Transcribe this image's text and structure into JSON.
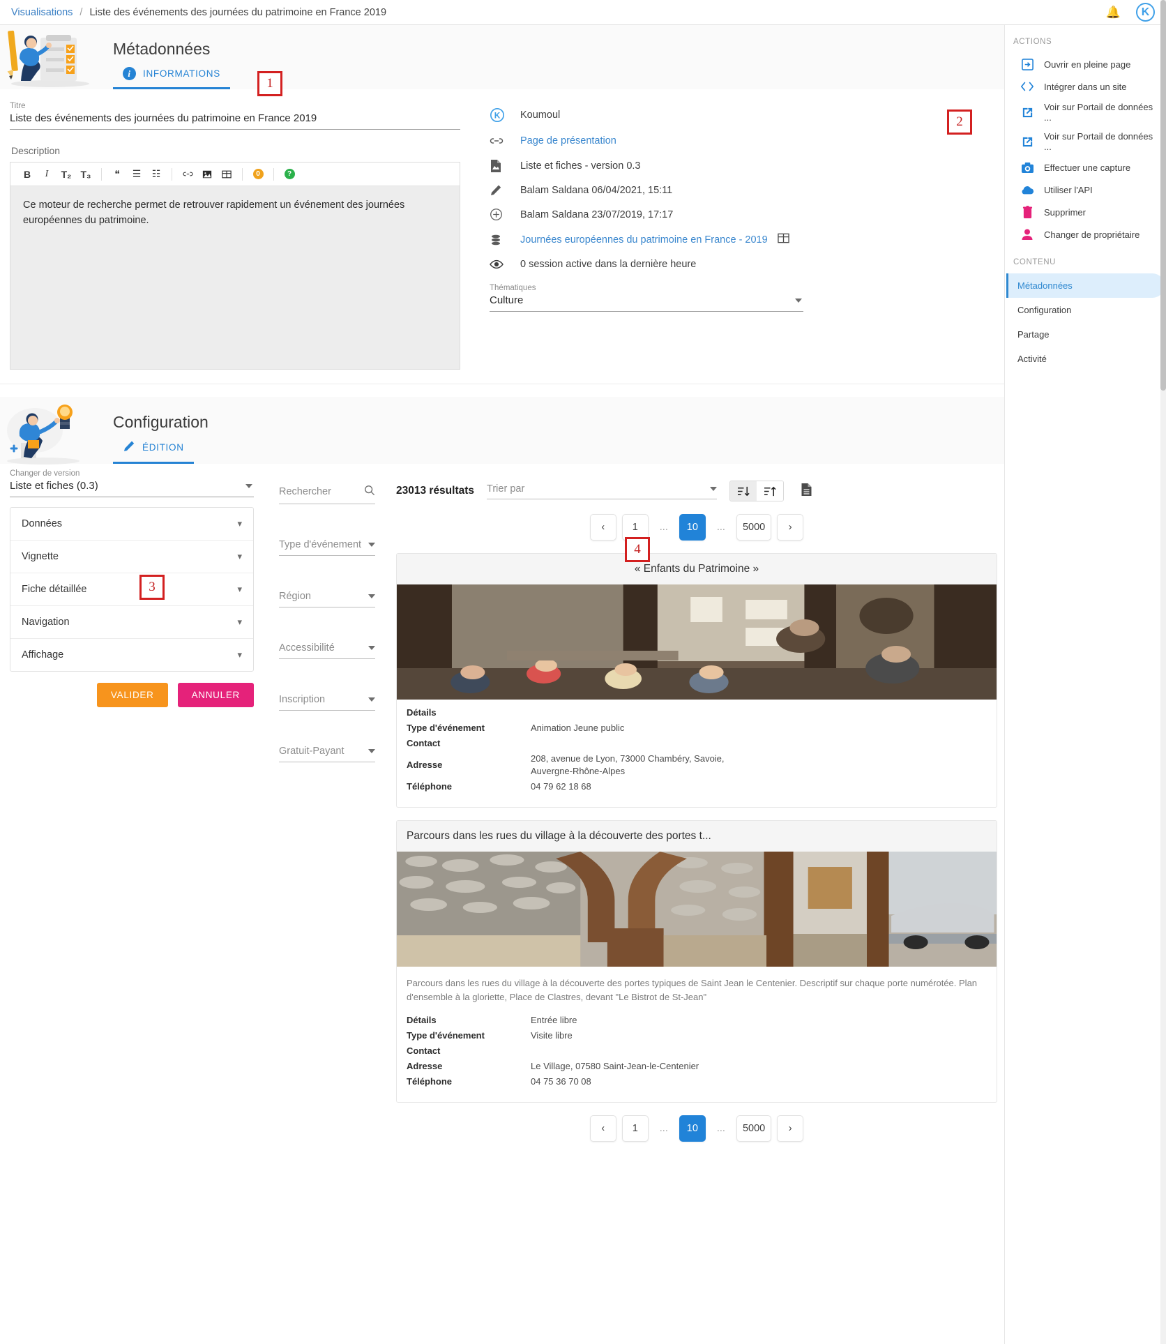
{
  "breadcrumb": {
    "root": "Visualisations",
    "separator": "/",
    "current": "Liste des événements des journées du patrimoine en France 2019"
  },
  "header": {
    "bell_icon": "bell-icon",
    "logo_letter": "K"
  },
  "metadata": {
    "title": "Métadonnées",
    "tab_label": "INFORMATIONS",
    "tab_icon": "info-icon",
    "titre_label": "Titre",
    "titre_value": "Liste des événements des journées du patrimoine en France 2019",
    "description_label": "Description",
    "description_text": "Ce moteur de recherche permet de retrouver rapidement un événement des journées européennes du patrimoine.",
    "toolbar": [
      {
        "name": "bold-icon",
        "glyph": "B"
      },
      {
        "name": "italic-icon",
        "glyph": "I"
      },
      {
        "name": "heading-2-icon",
        "glyph": "T₂"
      },
      {
        "name": "heading-3-icon",
        "glyph": "T₃"
      },
      {
        "name": "quote-icon",
        "glyph": "❝"
      },
      {
        "name": "bullet-list-icon",
        "glyph": "☰"
      },
      {
        "name": "numbered-list-icon",
        "glyph": "☷"
      },
      {
        "name": "link-icon",
        "glyph": "🔗"
      },
      {
        "name": "image-icon",
        "glyph": "▣"
      },
      {
        "name": "table-icon",
        "glyph": "⊞"
      },
      {
        "name": "preview-icon",
        "glyph": "0"
      },
      {
        "name": "help-icon",
        "glyph": "?"
      }
    ],
    "info_rows": [
      {
        "icon": "koumoul-logo-icon",
        "text": "Koumoul",
        "link": false
      },
      {
        "icon": "link-icon",
        "text": "Page de présentation",
        "link": true
      },
      {
        "icon": "file-icon",
        "text": "Liste et fiches - version 0.3",
        "link": false
      },
      {
        "icon": "pencil-icon",
        "text": "Balam Saldana 06/04/2021, 15:11",
        "link": false
      },
      {
        "icon": "plus-circle-icon",
        "text": "Balam Saldana 23/07/2019, 17:17",
        "link": false
      },
      {
        "icon": "database-icon",
        "text": "Journées européennes du patrimoine en France - 2019",
        "link": true,
        "trailing_icon": "table-icon"
      },
      {
        "icon": "eye-icon",
        "text": "0 session active dans la dernière heure",
        "link": false
      }
    ],
    "thematiques_label": "Thématiques",
    "thematiques_value": "Culture"
  },
  "rail": {
    "actions_header": "ACTIONS",
    "actions": [
      {
        "label": "Ouvrir en pleine page",
        "icon": "open-fullpage-icon",
        "color": "#2183d8"
      },
      {
        "label": "Intégrer dans un site",
        "icon": "code-embed-icon",
        "color": "#2183d8"
      },
      {
        "label": "Voir sur Portail de données ...",
        "icon": "external-link-icon",
        "color": "#2183d8"
      },
      {
        "label": "Voir sur Portail de données ...",
        "icon": "external-link-icon",
        "color": "#2183d8"
      },
      {
        "label": "Effectuer une capture",
        "icon": "camera-icon",
        "color": "#2183d8"
      },
      {
        "label": "Utiliser l'API",
        "icon": "cloud-icon",
        "color": "#2183d8"
      },
      {
        "label": "Supprimer",
        "icon": "trash-icon",
        "color": "#e5227a"
      },
      {
        "label": "Changer de propriétaire",
        "icon": "person-icon",
        "color": "#e5227a"
      }
    ],
    "contenu_header": "CONTENU",
    "contenu": [
      {
        "label": "Métadonnées",
        "active": true
      },
      {
        "label": "Configuration",
        "active": false
      },
      {
        "label": "Partage",
        "active": false
      },
      {
        "label": "Activité",
        "active": false
      }
    ]
  },
  "configuration": {
    "title": "Configuration",
    "tab_label": "ÉDITION",
    "tab_icon": "pencil-icon",
    "version_label": "Changer de version",
    "version_value": "Liste et fiches (0.3)",
    "sections": [
      {
        "label": "Données"
      },
      {
        "label": "Vignette"
      },
      {
        "label": "Fiche détaillée"
      },
      {
        "label": "Navigation"
      },
      {
        "label": "Affichage"
      }
    ],
    "validate_label": "VALIDER",
    "cancel_label": "ANNULER",
    "validate_color": "#f7941d",
    "cancel_color": "#e5227a"
  },
  "preview": {
    "filters": [
      {
        "label": "Rechercher",
        "icon": "search-icon",
        "type": "search"
      },
      {
        "label": "Type d'événement",
        "icon": "chevron-down-icon",
        "type": "select"
      },
      {
        "label": "Région",
        "icon": "chevron-down-icon",
        "type": "select"
      },
      {
        "label": "Accessibilité",
        "icon": "chevron-down-icon",
        "type": "select"
      },
      {
        "label": "Inscription",
        "icon": "chevron-down-icon",
        "type": "select"
      },
      {
        "label": "Gratuit-Payant",
        "icon": "chevron-down-icon",
        "type": "select"
      }
    ],
    "results_count": "23013 résultats",
    "sort_placeholder": "Trier par",
    "sort_desc_icon": "sort-descending-icon",
    "sort_asc_icon": "sort-ascending-icon",
    "download_icon": "download-file-icon",
    "pagination": {
      "prev": "‹",
      "next": "›",
      "first": "1",
      "dots": "...",
      "current": "10",
      "last": "5000"
    },
    "cards": [
      {
        "title": "« Enfants du Patrimoine »",
        "title_align": "center",
        "description": "",
        "rows": [
          {
            "k": "Détails",
            "v": ""
          },
          {
            "k": "Type d'événement",
            "v": "Animation Jeune public"
          },
          {
            "k": "Contact",
            "v": ""
          },
          {
            "k": "Adresse",
            "v": "208, avenue de Lyon, 73000 Chambéry, Savoie, Auvergne-Rhône-Alpes"
          },
          {
            "k": "Téléphone",
            "v": "04 79 62 18 68"
          }
        ]
      },
      {
        "title": "Parcours dans les rues du village à la découverte des portes t...",
        "title_align": "left",
        "description": "Parcours dans les rues du village à la découverte des portes typiques de Saint Jean le Centenier. Descriptif sur chaque porte numérotée. Plan d'ensemble à la gloriette, Place de Clastres, devant \"Le Bistrot de St-Jean\"",
        "rows": [
          {
            "k": "Détails",
            "v": "Entrée libre"
          },
          {
            "k": "Type d'événement",
            "v": "Visite libre"
          },
          {
            "k": "Contact",
            "v": ""
          },
          {
            "k": "Adresse",
            "v": "Le Village, 07580 Saint-Jean-le-Centenier"
          },
          {
            "k": "Téléphone",
            "v": "04 75 36 70 08"
          }
        ]
      }
    ]
  },
  "annotations": [
    {
      "label": "1"
    },
    {
      "label": "2"
    },
    {
      "label": "3"
    },
    {
      "label": "4"
    }
  ]
}
